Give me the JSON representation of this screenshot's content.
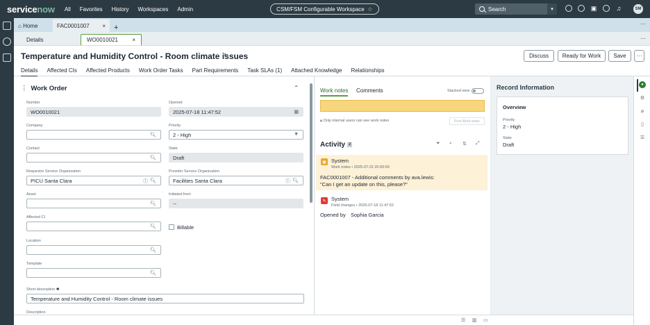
{
  "topnav": {
    "logo_a": "service",
    "logo_b": "now",
    "links": [
      "All",
      "Favorites",
      "History",
      "Workspaces",
      "Admin"
    ],
    "workspace": "CSM/FSM Configurable Workspace",
    "search_placeholder": "Search",
    "avatar_initials": "SM"
  },
  "tabs": {
    "home": "Home",
    "record_tab": "FAC0001007",
    "details": "Details",
    "wo_tab": "WO0010021"
  },
  "header": {
    "title": "Temperature and Humidity Control - Room climate issues",
    "buttons": {
      "discuss": "Discuss",
      "ready": "Ready for Work",
      "save": "Save"
    },
    "subtabs": [
      "Details",
      "Affected CIs",
      "Affected Products",
      "Work Order Tasks",
      "Part Requirements",
      "Task SLAs (1)",
      "Attached Knowledge",
      "Relationships"
    ]
  },
  "form": {
    "section": "Work Order",
    "number_label": "Number",
    "number": "WO0010021",
    "opened_label": "Opened",
    "opened": "2025-07-18 11:47:52",
    "company_label": "Company",
    "priority_label": "Priority",
    "priority": "2 - High",
    "contact_label": "Contact",
    "state_label": "State",
    "state": "Draft",
    "requestor_label": "Requestor Service Organization",
    "requestor": "PICU Santa Clara",
    "provider_label": "Provider Service Organization",
    "provider": "Facilities Santa Clara",
    "asset_label": "Asset",
    "initiated_label": "Initiated from",
    "initiated": "--",
    "affected_ci_label": "Affected CI",
    "billable_label": "Billable",
    "location_label": "Location",
    "template_label": "Template",
    "short_desc_label": "Short description",
    "short_desc": "Temperature and Humidity Control - Room climate issues",
    "description_label": "Description"
  },
  "activity": {
    "tab_notes": "Work notes",
    "tab_comments": "Comments",
    "stacked": "Stacked view",
    "hint": "Only internal users can see work notes",
    "post": "Post Work notes",
    "heading": "Activity",
    "count": "2",
    "entries": [
      {
        "author": "System",
        "meta": "Work notes • 2025-07-22 20:00:50",
        "line1": "FAC0001007 - Additional comments by ava.lewis:",
        "line2": "\"Can I get an update on this, please?\""
      },
      {
        "author": "System",
        "meta": "Field changes • 2025-07-18 11:47:52",
        "opened_by_label": "Opened by",
        "opened_by": "Sophia Garcia"
      }
    ]
  },
  "record_info": {
    "heading": "Record Information",
    "overview": "Overview",
    "priority_label": "Priority",
    "priority": "2 - High",
    "state_label": "State",
    "state": "Draft"
  },
  "colors": {
    "nav": "#2c3b43",
    "accent": "#5b9d43",
    "note": "#f8d67d"
  }
}
